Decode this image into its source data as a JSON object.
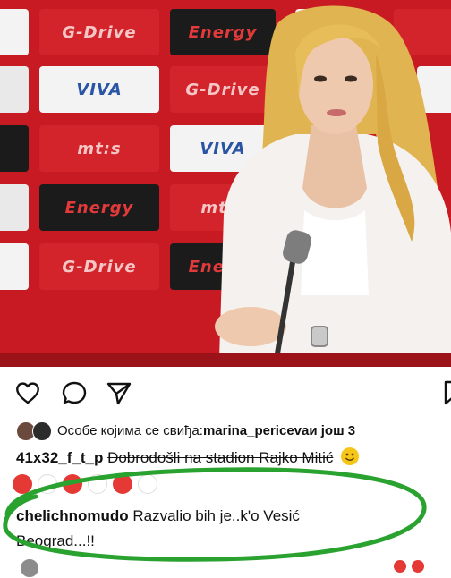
{
  "colors": {
    "backdrop_red": "#c71a22",
    "highlight_oval": "#2aa22f",
    "text": "#111111"
  },
  "backdrop_brands": [
    "G-Drive",
    "Energy",
    "VIVA",
    "mt:s"
  ],
  "icons": {
    "like": "heart-outline-icon",
    "comment": "speech-bubble-icon",
    "share": "paper-plane-icon",
    "save": "bookmark-icon"
  },
  "likes": {
    "prefix": "Особе којима се свиђа: ",
    "user": "marina_periceva",
    "suffix": " и још 3"
  },
  "caption": {
    "user": "41x32_f_t_p",
    "text": "Dobrodošli na stadion Rajko Mitić"
  },
  "comment": {
    "user": "chelichnomudo",
    "text": "Razvalio bih je..k'o Vesić Beograd...!!"
  }
}
